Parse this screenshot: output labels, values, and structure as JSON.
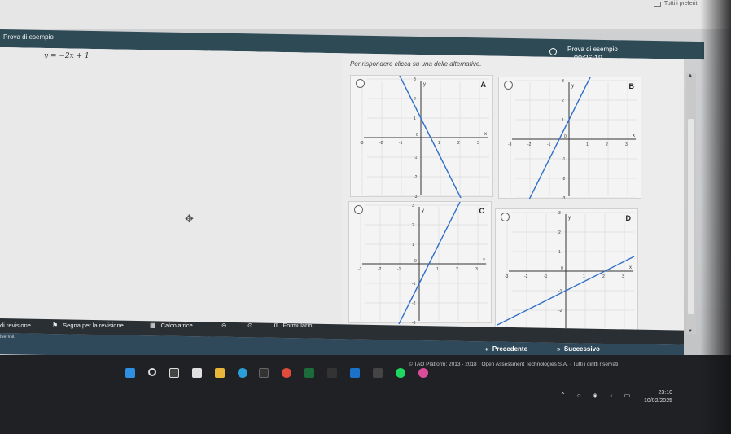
{
  "browser": {
    "favorites_label": "Tutti i preferiti"
  },
  "header": {
    "title": "Prova di esempio"
  },
  "timer": {
    "title": "Prova di esempio",
    "value": "00:26:19"
  },
  "question": {
    "formula": "y = −2x + 1",
    "prompt": "Per rispondere clicca su una delle alternative."
  },
  "choices": [
    {
      "letter": "A",
      "slope": -2,
      "intercept": 1
    },
    {
      "letter": "B",
      "slope": 2,
      "intercept": 1
    },
    {
      "letter": "C",
      "slope": 2,
      "intercept": -1
    },
    {
      "letter": "D",
      "slope": 0.5,
      "intercept": -1
    }
  ],
  "graph_labels": {
    "x_axis": "x",
    "y_axis": "y",
    "ticks": [
      "-3",
      "-2",
      "-1",
      "0",
      "1",
      "2",
      "3"
    ]
  },
  "toolbar": {
    "review": "di revisione",
    "flag": "Segna per la revisione",
    "calculator": "Calcolatrice",
    "formulario": "Formulario"
  },
  "footer": {
    "rights_short": "iservati",
    "prev": "Precedente",
    "next": "Successivo",
    "copyright": "© TAO Platform: 2013 - 2018 · Open Assessment Technologies S.A. · Tutti i diritti riservati"
  },
  "taskbar": {
    "time": "23:10",
    "date": "10/02/2025"
  },
  "icons": {
    "timer": "clock-icon",
    "flag": "flag-icon",
    "calculator": "calculator-icon",
    "formulario": "pi-icon",
    "prev": "double-left-arrow-icon",
    "next": "double-right-arrow-icon"
  }
}
